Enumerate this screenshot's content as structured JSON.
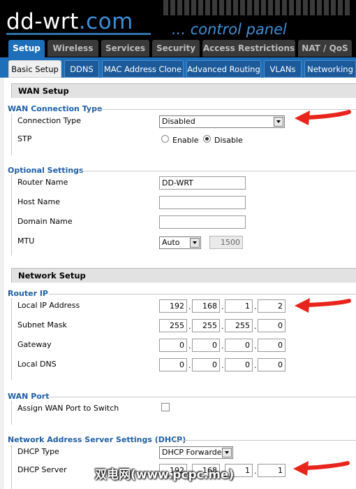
{
  "logo": {
    "part1": "dd-wrt",
    "part2": ".com"
  },
  "tagline": "... control panel",
  "tabs": [
    {
      "label": "Setup",
      "active": true
    },
    {
      "label": "Wireless"
    },
    {
      "label": "Services"
    },
    {
      "label": "Security"
    },
    {
      "label": "Access Restrictions"
    },
    {
      "label": "NAT / QoS"
    }
  ],
  "subtabs": [
    {
      "label": "Basic Setup",
      "active": true
    },
    {
      "label": "DDNS"
    },
    {
      "label": "MAC Address Clone"
    },
    {
      "label": "Advanced Routing"
    },
    {
      "label": "VLANs"
    },
    {
      "label": "Networking"
    }
  ],
  "wan_setup": {
    "title": "WAN Setup",
    "connection": {
      "title": "WAN Connection Type",
      "type_label": "Connection Type",
      "type_value": "Disabled",
      "stp_label": "STP",
      "stp_enable": "Enable",
      "stp_disable": "Disable",
      "stp_selected": "Disable"
    },
    "optional": {
      "title": "Optional Settings",
      "router_name_label": "Router Name",
      "router_name_value": "DD-WRT",
      "host_name_label": "Host Name",
      "host_name_value": "",
      "domain_name_label": "Domain Name",
      "domain_name_value": "",
      "mtu_label": "MTU",
      "mtu_mode": "Auto",
      "mtu_value": "1500"
    }
  },
  "network_setup": {
    "title": "Network Setup",
    "router_ip": {
      "title": "Router IP",
      "local_ip_label": "Local IP Address",
      "local_ip": [
        "192",
        "168",
        "1",
        "2"
      ],
      "subnet_label": "Subnet Mask",
      "subnet": [
        "255",
        "255",
        "255",
        "0"
      ],
      "gateway_label": "Gateway",
      "gateway": [
        "0",
        "0",
        "0",
        "0"
      ],
      "dns_label": "Local DNS",
      "dns": [
        "0",
        "0",
        "0",
        "0"
      ]
    },
    "wan_port": {
      "title": "WAN Port",
      "assign_label": "Assign WAN Port to Switch",
      "assign_checked": false
    },
    "dhcp": {
      "title": "Network Address Server Settings (DHCP)",
      "type_label": "DHCP Type",
      "type_value": "DHCP Forwarder",
      "server_label": "DHCP Server",
      "server": [
        "192",
        "168",
        "1",
        "1"
      ]
    }
  },
  "watermark": "双电网(www.pcpc.me)",
  "colors": {
    "accent": "#1e6fba",
    "group_title": "#1e5ea3",
    "annotation": "#e8241c"
  }
}
